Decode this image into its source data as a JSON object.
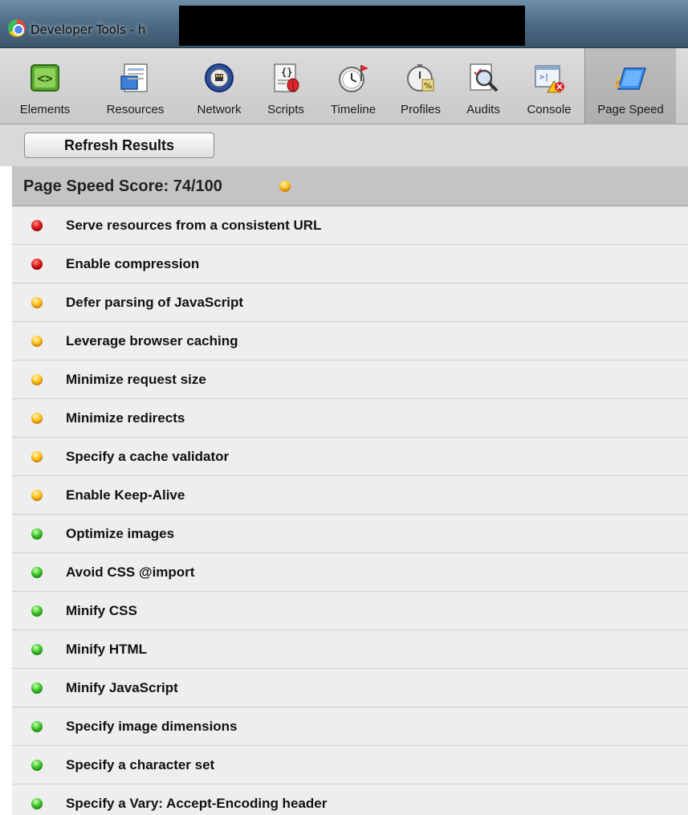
{
  "window": {
    "title": "Developer Tools - h"
  },
  "toolbar": {
    "items": [
      {
        "label": "Elements",
        "icon": "elements-icon"
      },
      {
        "label": "Resources",
        "icon": "resources-icon"
      },
      {
        "label": "Network",
        "icon": "network-icon"
      },
      {
        "label": "Scripts",
        "icon": "scripts-icon"
      },
      {
        "label": "Timeline",
        "icon": "timeline-icon"
      },
      {
        "label": "Profiles",
        "icon": "profiles-icon"
      },
      {
        "label": "Audits",
        "icon": "audits-icon"
      },
      {
        "label": "Console",
        "icon": "console-icon"
      },
      {
        "label": "Page Speed",
        "icon": "page-speed-icon",
        "active": true
      }
    ]
  },
  "refresh": {
    "label": "Refresh Results"
  },
  "score": {
    "label": "Page Speed Score: 74/100",
    "status": "orange"
  },
  "colors": {
    "red": "#e01818",
    "orange": "#ffc21a",
    "green": "#3ec82a"
  },
  "rules": [
    {
      "label": "Serve resources from a consistent URL",
      "status": "red"
    },
    {
      "label": "Enable compression",
      "status": "red"
    },
    {
      "label": "Defer parsing of JavaScript",
      "status": "orange"
    },
    {
      "label": "Leverage browser caching",
      "status": "orange"
    },
    {
      "label": "Minimize request size",
      "status": "orange"
    },
    {
      "label": "Minimize redirects",
      "status": "orange"
    },
    {
      "label": "Specify a cache validator",
      "status": "orange"
    },
    {
      "label": "Enable Keep-Alive",
      "status": "orange"
    },
    {
      "label": "Optimize images",
      "status": "green"
    },
    {
      "label": "Avoid CSS @import",
      "status": "green"
    },
    {
      "label": "Minify CSS",
      "status": "green"
    },
    {
      "label": "Minify HTML",
      "status": "green"
    },
    {
      "label": "Minify JavaScript",
      "status": "green"
    },
    {
      "label": "Specify image dimensions",
      "status": "green"
    },
    {
      "label": "Specify a character set",
      "status": "green"
    },
    {
      "label": "Specify a Vary: Accept-Encoding header",
      "status": "green"
    }
  ]
}
